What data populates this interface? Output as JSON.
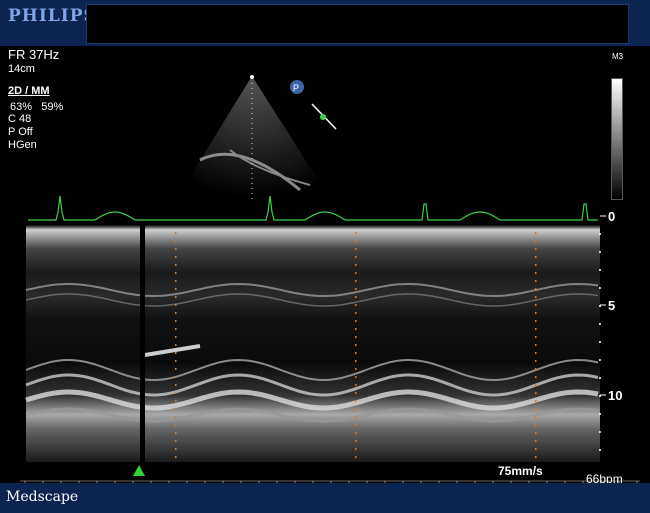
{
  "header": {
    "logo": "PHILIPS"
  },
  "info": {
    "frame_rate": "FR 37Hz",
    "depth": "14cm",
    "mode": "2D / MM",
    "gain_2d": "63%",
    "gain_mm": "59%",
    "chroma": "C 48",
    "persistence": "P Off",
    "harmonics": "HGen"
  },
  "probe_label": "M3",
  "depth_scale": [
    "0",
    "5",
    "10"
  ],
  "sweep_speed": "75mm/s",
  "heart_rate": "66bpm",
  "footer": {
    "brand": "Medscape"
  },
  "colors": {
    "header_bg": "#0b2450",
    "ecg": "#3bd14a",
    "timing_dots": "#d4782e",
    "marker": "#2fd42f"
  }
}
